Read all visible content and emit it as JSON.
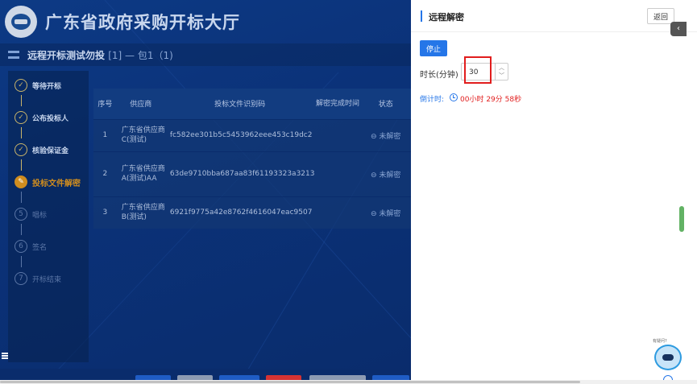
{
  "header": {
    "portal_title": "广东省政府采购开标大厅",
    "project_title": "远程开标测试勿投",
    "project_suffix": "[1] — 包1（1)"
  },
  "steps": [
    {
      "label": "等待开标",
      "state": "done"
    },
    {
      "label": "公布投标人",
      "state": "done"
    },
    {
      "label": "核验保证金",
      "state": "done"
    },
    {
      "label": "投标文件解密",
      "state": "active"
    },
    {
      "label": "唱标",
      "state": "pending",
      "num": "5"
    },
    {
      "label": "签名",
      "state": "pending",
      "num": "6"
    },
    {
      "label": "开标结束",
      "state": "pending",
      "num": "7"
    }
  ],
  "table": {
    "headers": [
      "序号",
      "供应商",
      "投标文件识别码",
      "解密完成时间",
      "状态"
    ],
    "rows": [
      {
        "seq": "1",
        "supplier": "广东省供应商C(测试)",
        "code": "fc582ee301b5c5453962eee453c19dc2",
        "time": "",
        "status": "⊖ 未解密"
      },
      {
        "seq": "2",
        "supplier": "广东省供应商A(测试)AA",
        "code": "63de9710bba687aa83f61193323a3213",
        "time": "",
        "status": "⊖ 未解密"
      },
      {
        "seq": "3",
        "supplier": "广东省供应商B(测试)",
        "code": "6921f9775a42e8762f4616047eac9507",
        "time": "",
        "status": "⊖ 未解密"
      }
    ]
  },
  "drawer": {
    "title": "远程解密",
    "back_label": "返回",
    "collapse_glyph": "‹",
    "stop_label": "停止",
    "duration_label": "时长(分钟)",
    "duration_value": "30",
    "stepper_up": "︿",
    "stepper_down": "﹀",
    "countdown_label": "倒计时:",
    "countdown_value": "00小时 29分 58秒",
    "help_label": "有疑问?"
  },
  "colors": {
    "accent": "#2576e8",
    "danger": "#e11d1d",
    "active_step": "#d08d1f",
    "app_bg": "#0b3279"
  }
}
